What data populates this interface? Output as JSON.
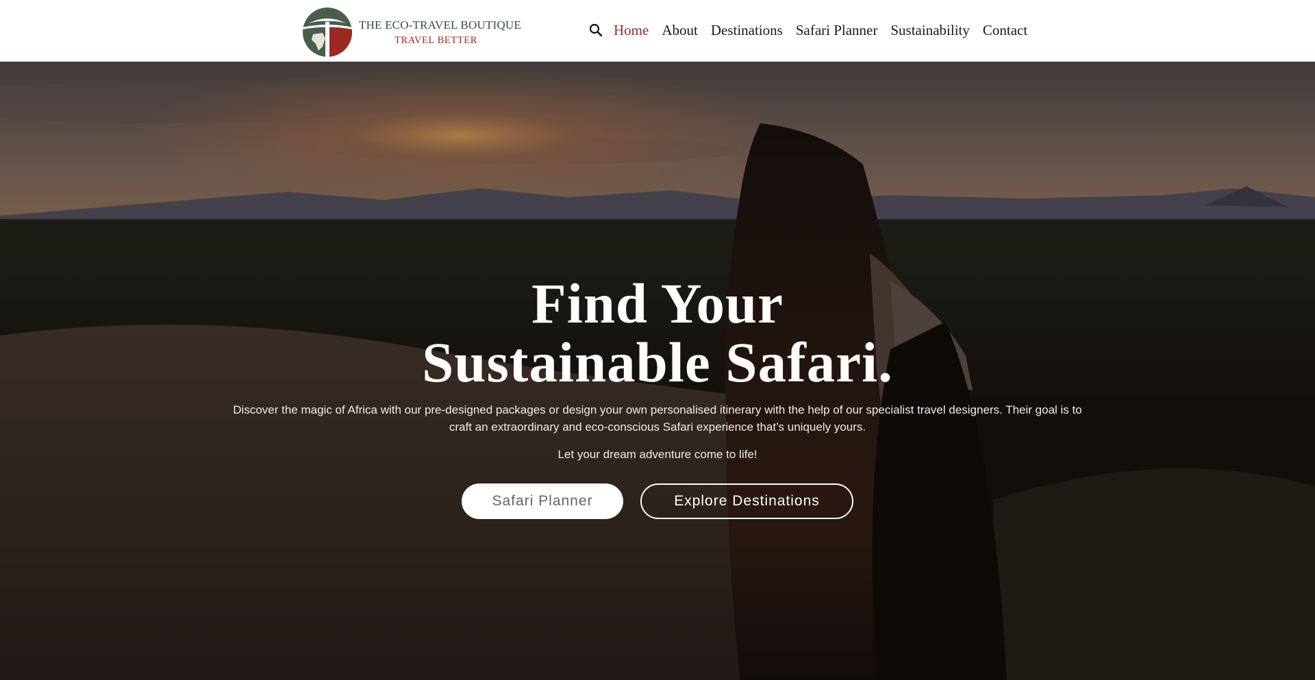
{
  "header": {
    "brand_name": "THE ECO-TRAVEL BOUTIQUE",
    "brand_tagline": "TRAVEL BETTER",
    "search_icon": "search-icon",
    "nav": [
      {
        "label": "Home",
        "active": true
      },
      {
        "label": "About",
        "active": false
      },
      {
        "label": "Destinations",
        "active": false
      },
      {
        "label": "Safari Planner",
        "active": false
      },
      {
        "label": "Sustainability",
        "active": false
      },
      {
        "label": "Contact",
        "active": false
      }
    ]
  },
  "hero": {
    "title_line1": "Find Your",
    "title_line2": "Sustainable Safari.",
    "description": "Discover the magic of Africa with our pre-designed packages or design your own personalised itinerary with the help of our specialist travel designers. Their goal is to craft an extraordinary and eco-conscious Safari experience that’s uniquely yours.",
    "cta_text": "Let your dream adventure come to life!",
    "primary_button": "Safari Planner",
    "secondary_button": "Explore Destinations"
  },
  "colors": {
    "accent": "#9b2a22",
    "logo_green": "#4a5e4e",
    "header_bg": "#ffffff"
  }
}
